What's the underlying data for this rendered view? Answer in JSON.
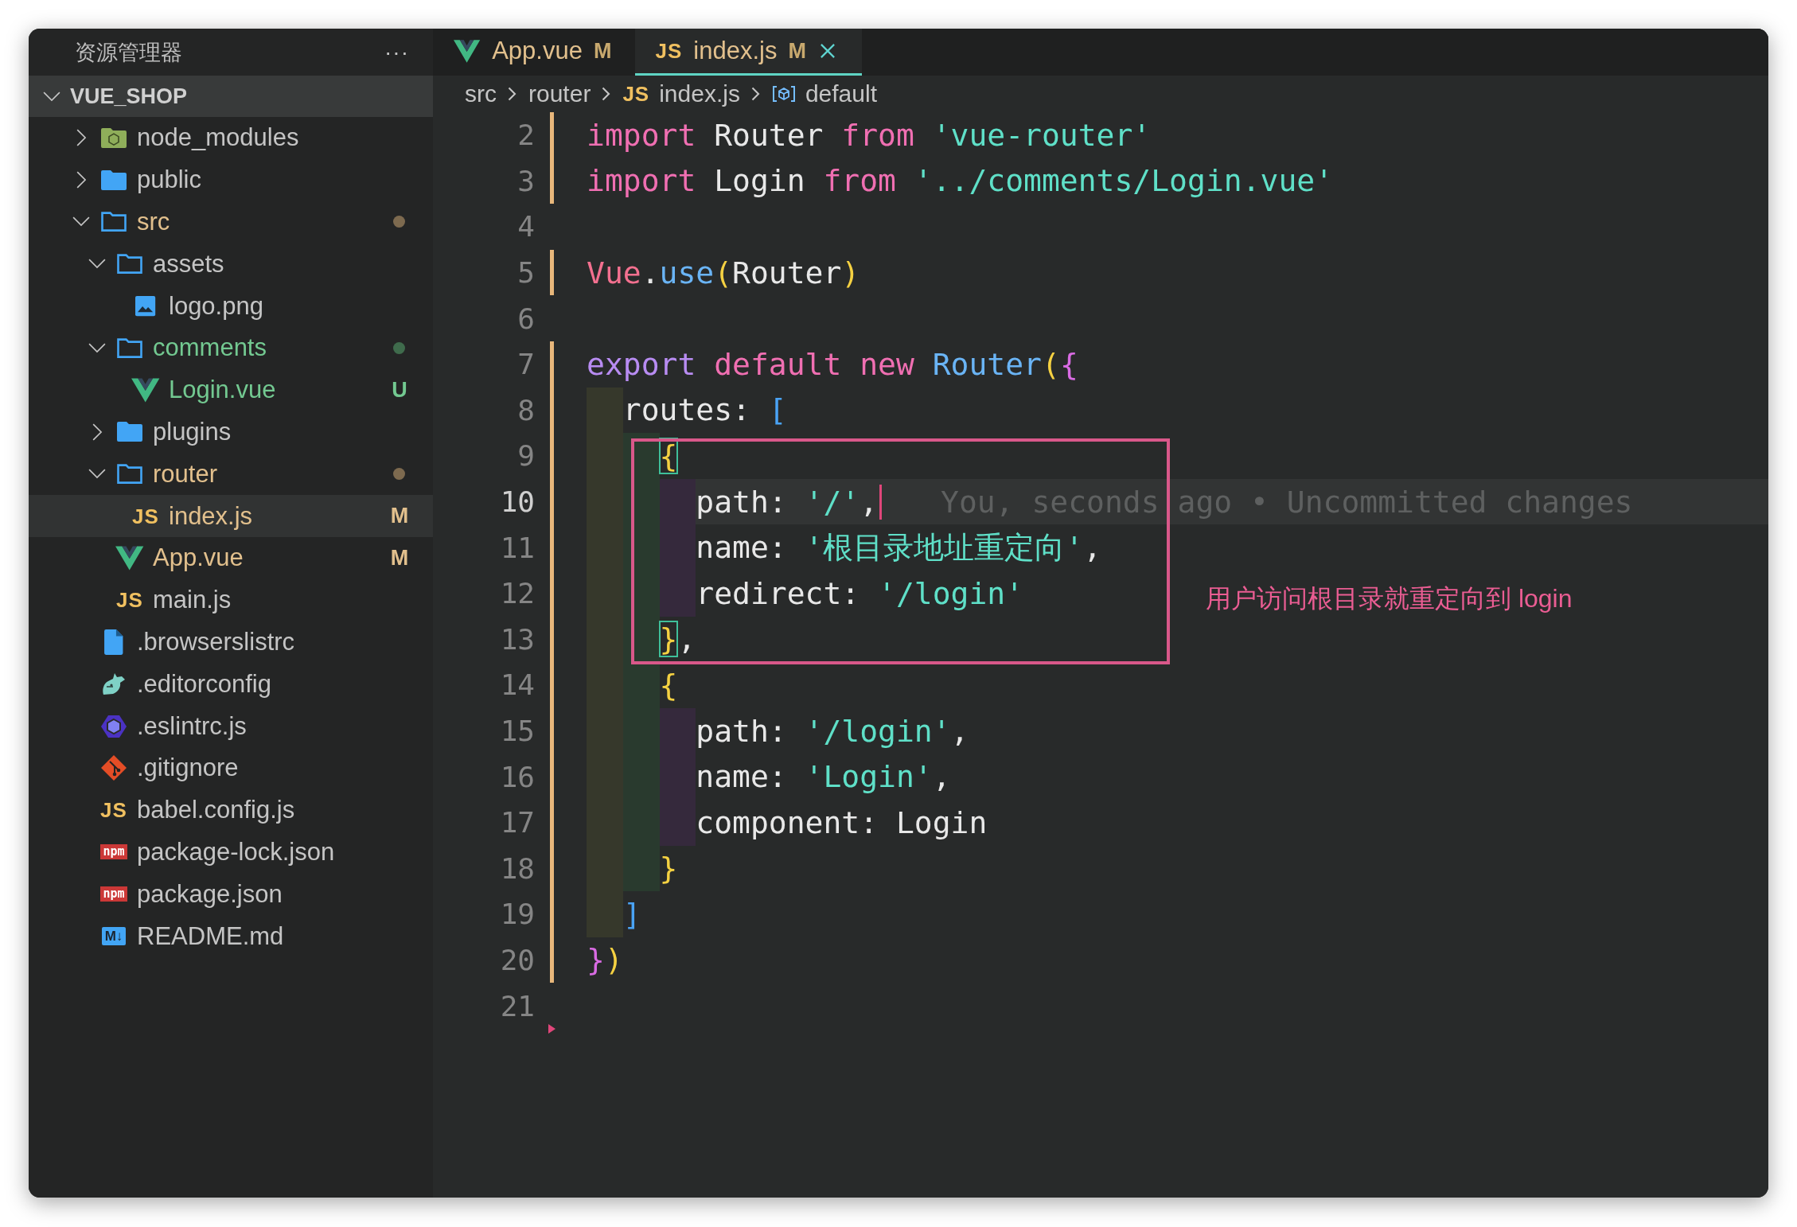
{
  "explorer": {
    "title": "资源管理器",
    "more": "···",
    "root": {
      "label": "VUE_SHOP",
      "expanded": true
    },
    "tree": [
      {
        "label": "node_modules",
        "kind": "node-folder",
        "expanded": false,
        "modified": false,
        "untracked": false,
        "selected": false
      },
      {
        "label": "public",
        "kind": "folder",
        "expanded": false,
        "modified": false,
        "untracked": false,
        "selected": false
      },
      {
        "label": "src",
        "kind": "folder",
        "expanded": true,
        "modified": true,
        "untracked": false,
        "selected": false,
        "children": [
          {
            "label": "assets",
            "kind": "folder",
            "expanded": true,
            "modified": false,
            "untracked": false,
            "selected": false,
            "children": [
              {
                "label": "logo.png",
                "kind": "image",
                "modified": false,
                "untracked": false,
                "selected": false
              }
            ]
          },
          {
            "label": "comments",
            "kind": "folder",
            "expanded": true,
            "modified": false,
            "untracked": true,
            "selected": false,
            "children": [
              {
                "label": "Login.vue",
                "kind": "vue",
                "modified": false,
                "untracked": true,
                "badge": "U",
                "selected": false
              }
            ]
          },
          {
            "label": "plugins",
            "kind": "folder",
            "expanded": false,
            "modified": false,
            "untracked": false,
            "selected": false
          },
          {
            "label": "router",
            "kind": "folder",
            "expanded": true,
            "modified": true,
            "untracked": false,
            "selected": false,
            "children": [
              {
                "label": "index.js",
                "kind": "js",
                "glyph": "JS",
                "modified": true,
                "untracked": false,
                "badge": "M",
                "selected": true
              }
            ]
          },
          {
            "label": "App.vue",
            "kind": "vue",
            "modified": true,
            "untracked": false,
            "badge": "M",
            "selected": false
          },
          {
            "label": "main.js",
            "kind": "js",
            "glyph": "JS",
            "modified": false,
            "untracked": false,
            "selected": false
          }
        ]
      },
      {
        "label": ".browserslistrc",
        "kind": "file",
        "modified": false,
        "untracked": false,
        "selected": false
      },
      {
        "label": ".editorconfig",
        "kind": "editorconfig",
        "modified": false,
        "untracked": false,
        "selected": false
      },
      {
        "label": ".eslintrc.js",
        "kind": "eslint",
        "modified": false,
        "untracked": false,
        "selected": false
      },
      {
        "label": ".gitignore",
        "kind": "git",
        "modified": false,
        "untracked": false,
        "selected": false
      },
      {
        "label": "babel.config.js",
        "kind": "js",
        "glyph": "JS",
        "modified": false,
        "untracked": false,
        "selected": false
      },
      {
        "label": "package-lock.json",
        "kind": "npm",
        "glyph": "npm",
        "modified": false,
        "untracked": false,
        "selected": false
      },
      {
        "label": "package.json",
        "kind": "npm",
        "glyph": "npm",
        "modified": false,
        "untracked": false,
        "selected": false
      },
      {
        "label": "README.md",
        "kind": "markdown",
        "glyph": "M↓",
        "modified": false,
        "untracked": false,
        "selected": false
      }
    ]
  },
  "tabs": [
    {
      "label": "App.vue",
      "kind": "vue",
      "badge": "M",
      "modified": true,
      "selected": false
    },
    {
      "label": "index.js",
      "kind": "js",
      "glyph": "JS",
      "badge": "M",
      "modified": true,
      "selected": true
    }
  ],
  "breadcrumbs": [
    {
      "label": "src",
      "kind": "folder"
    },
    {
      "label": "router",
      "kind": "folder"
    },
    {
      "label": "index.js",
      "kind": "js",
      "glyph": "JS"
    },
    {
      "label": "default",
      "kind": "symbol"
    }
  ],
  "editor": {
    "lines": [
      {
        "number": "2",
        "changed": true,
        "deleted": false,
        "current": false,
        "tokens": [
          {
            "kind": "kw",
            "text": "import"
          },
          {
            "kind": "plain",
            "text": " Router "
          },
          {
            "kind": "kw",
            "text": "from"
          },
          {
            "kind": "str",
            "text": " 'vue-router'"
          }
        ]
      },
      {
        "number": "3",
        "changed": true,
        "deleted": false,
        "current": false,
        "tokens": [
          {
            "kind": "kw",
            "text": "import"
          },
          {
            "kind": "plain",
            "text": " Login "
          },
          {
            "kind": "kw",
            "text": "from"
          },
          {
            "kind": "str",
            "text": " '../comments/Login.vue'"
          }
        ]
      },
      {
        "number": "4",
        "changed": false,
        "deleted": false,
        "current": false
      },
      {
        "number": "5",
        "changed": true,
        "deleted": false,
        "current": false,
        "tokens": [
          {
            "kind": "global",
            "text": "Vue"
          },
          {
            "kind": "plain",
            "text": "."
          },
          {
            "kind": "fn",
            "text": "use"
          },
          {
            "kind": "b1",
            "text": "("
          },
          {
            "kind": "plain",
            "text": "Router"
          },
          {
            "kind": "b1",
            "text": ")"
          }
        ]
      },
      {
        "number": "6",
        "changed": false,
        "deleted": false,
        "current": false
      },
      {
        "number": "7",
        "changed": true,
        "deleted": false,
        "current": false,
        "tokens": [
          {
            "kind": "kw2",
            "text": "export"
          },
          {
            "kind": "kw",
            "text": " default"
          },
          {
            "kind": "kw",
            "text": " new"
          },
          {
            "kind": "fn",
            "text": " Router"
          },
          {
            "kind": "b1",
            "text": "("
          },
          {
            "kind": "b2",
            "text": "{"
          }
        ]
      },
      {
        "number": "8",
        "changed": true,
        "deleted": false,
        "current": false,
        "tokens": [
          {
            "kind": "plain",
            "text": "  routes: "
          },
          {
            "kind": "b3",
            "text": "["
          }
        ]
      },
      {
        "number": "9",
        "changed": true,
        "deleted": false,
        "current": false,
        "tokens": [
          {
            "kind": "bracket-match",
            "text": "    {"
          }
        ]
      },
      {
        "number": "10",
        "changed": true,
        "deleted": false,
        "current": true,
        "tokens": [
          {
            "kind": "plain",
            "text": "      path: "
          },
          {
            "kind": "str",
            "text": "'/'"
          },
          {
            "kind": "plain",
            "text": ","
          }
        ],
        "blame": "You, seconds ago • Uncommitted changes"
      },
      {
        "number": "11",
        "changed": true,
        "deleted": false,
        "current": false,
        "tokens": [
          {
            "kind": "plain",
            "text": "      name: "
          },
          {
            "kind": "str",
            "text": "'根目录地址重定向'"
          },
          {
            "kind": "plain",
            "text": ","
          }
        ]
      },
      {
        "number": "12",
        "changed": true,
        "deleted": false,
        "current": false,
        "tokens": [
          {
            "kind": "plain",
            "text": "      redirect: "
          },
          {
            "kind": "str",
            "text": "'/login'"
          }
        ]
      },
      {
        "number": "13",
        "changed": true,
        "deleted": false,
        "current": false,
        "tokens": [
          {
            "kind": "bracket-match",
            "text": "    }"
          },
          {
            "kind": "plain",
            "text": ","
          }
        ]
      },
      {
        "number": "14",
        "changed": true,
        "deleted": false,
        "current": false,
        "tokens": [
          {
            "kind": "b1",
            "text": "    {"
          }
        ]
      },
      {
        "number": "15",
        "changed": true,
        "deleted": false,
        "current": false,
        "tokens": [
          {
            "kind": "plain",
            "text": "      path: "
          },
          {
            "kind": "str",
            "text": "'/login'"
          },
          {
            "kind": "plain",
            "text": ","
          }
        ]
      },
      {
        "number": "16",
        "changed": true,
        "deleted": false,
        "current": false,
        "tokens": [
          {
            "kind": "plain",
            "text": "      name: "
          },
          {
            "kind": "str",
            "text": "'Login'"
          },
          {
            "kind": "plain",
            "text": ","
          }
        ]
      },
      {
        "number": "17",
        "changed": true,
        "deleted": false,
        "current": false,
        "tokens": [
          {
            "kind": "plain",
            "text": "      component: Login"
          }
        ]
      },
      {
        "number": "18",
        "changed": true,
        "deleted": false,
        "current": false,
        "tokens": [
          {
            "kind": "b1",
            "text": "    }"
          }
        ]
      },
      {
        "number": "19",
        "changed": true,
        "deleted": false,
        "current": false,
        "tokens": [
          {
            "kind": "b3",
            "text": "  ]"
          }
        ]
      },
      {
        "number": "20",
        "changed": true,
        "deleted": false,
        "current": false,
        "tokens": [
          {
            "kind": "b2",
            "text": "}"
          },
          {
            "kind": "b1",
            "text": ")"
          }
        ]
      },
      {
        "number": "21",
        "changed": false,
        "deleted": true,
        "current": false
      }
    ],
    "annotation": {
      "note": "用户访问根目录就重定向到 login"
    }
  }
}
